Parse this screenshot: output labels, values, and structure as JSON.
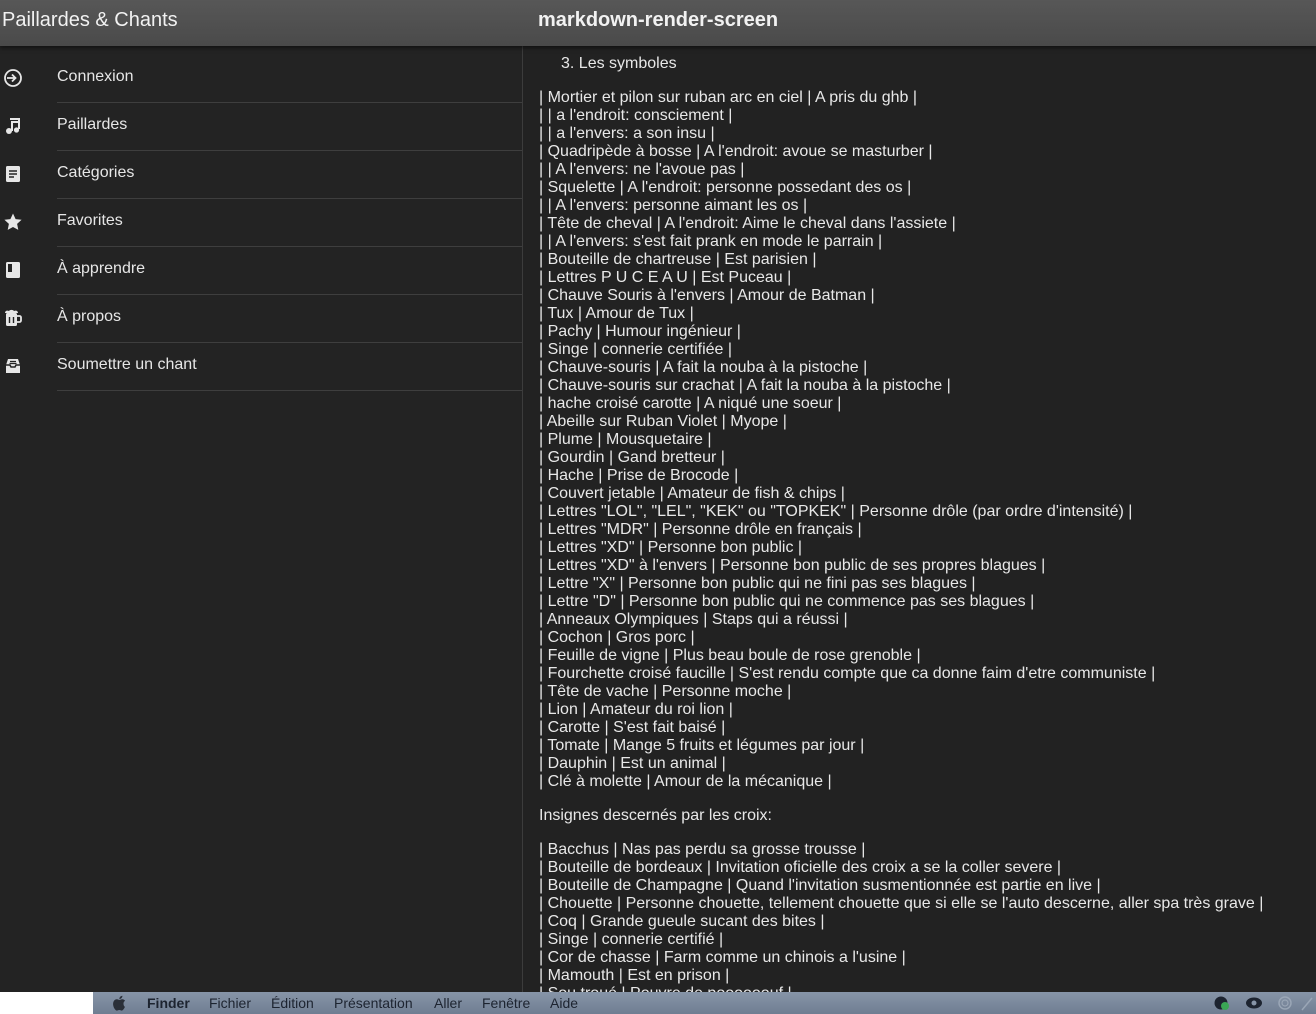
{
  "header": {
    "app_title": "Paillardes & Chants",
    "screen_title": "markdown-render-screen"
  },
  "sidebar": {
    "items": [
      {
        "label": "Connexion",
        "icon": "login-icon"
      },
      {
        "label": "Paillardes",
        "icon": "music-note-icon"
      },
      {
        "label": "Catégories",
        "icon": "document-icon"
      },
      {
        "label": "Favorites",
        "icon": "star-icon"
      },
      {
        "label": "À apprendre",
        "icon": "book-icon"
      },
      {
        "label": "À propos",
        "icon": "beer-mug-icon"
      },
      {
        "label": "Soumettre un chant",
        "icon": "inbox-icon"
      }
    ]
  },
  "content": {
    "ol_item": "3. Les symboles",
    "symbols_lines": [
      "| Mortier et pilon sur ruban arc en ciel | A pris du ghb |",
      "| | a l'endroit: consciement |",
      "| | a l'envers: a son insu |",
      "| Quadripède à bosse | A l'endroit: avoue se masturber |",
      "| | A l'envers: ne l'avoue pas |",
      "| Squelette | A l'endroit: personne possedant des os |",
      "| | A l'envers: personne aimant les os |",
      "| Tête de cheval | A l'endroit: Aime le cheval dans l'assiete |",
      "| | A l'envers: s'est fait prank en mode le parrain |",
      "| Bouteille de chartreuse | Est parisien |",
      "| Lettres P U C E A U | Est Puceau |",
      "| Chauve Souris à l'envers | Amour de Batman |",
      "| Tux | Amour de Tux |",
      "| Pachy | Humour ingénieur |",
      "| Singe | connerie certifiée |",
      "| Chauve-souris | A fait la nouba à la pistoche |",
      "| Chauve-souris sur crachat | A fait la nouba à la pistoche |",
      "| hache croisé carotte | A niqué une soeur |",
      "| Abeille sur Ruban Violet | Myope |",
      "| Plume | Mousquetaire |",
      "| Gourdin | Gand bretteur |",
      "| Hache | Prise de Brocode |",
      "| Couvert jetable | Amateur de fish & chips |",
      "| Lettres \"LOL\", \"LEL\", \"KEK\" ou \"TOPKEK\" | Personne drôle (par ordre d'intensité) |",
      "| Lettres \"MDR\" | Personne drôle en français |",
      "| Lettres \"XD\" | Personne bon public |",
      "| Lettres \"XD\" à l'envers | Personne bon public de ses propres blagues |",
      "| Lettre \"X\" | Personne bon public qui ne fini pas ses blagues |",
      "| Lettre \"D\" | Personne bon public qui ne commence pas ses blagues |",
      "| Anneaux Olympiques | Staps qui a réussi |",
      "| Cochon | Gros porc |",
      "| Feuille de vigne | Plus beau boule de rose grenoble |",
      "| Fourchette croisé faucille | S'est rendu compte que ca donne faim d'etre communiste |",
      "| Tête de vache | Personne moche |",
      "| Lion | Amateur du roi lion |",
      "| Carotte | S'est fait baisé |",
      "| Tomate | Mange 5 fruits et légumes par jour |",
      "| Dauphin | Est un animal |",
      "| Clé à molette | Amour de la mécanique |"
    ],
    "croix_heading": "Insignes descernés par les croix:",
    "croix_lines": [
      "| Bacchus | Nas pas perdu sa grosse trousse |",
      "| Bouteille de bordeaux | Invitation oficielle des croix a se la coller severe |",
      "| Bouteille de Champagne | Quand l'invitation susmentionnée est partie en live |",
      "| Chouette | Personne chouette, tellement chouette que si elle se l'auto descerne, aller spa très grave |",
      "| Coq | Grande gueule sucant des bites |",
      "| Singe | connerie certifié |",
      "| Cor de chasse | Farm comme un chinois a l'usine |",
      "| Mamouth | Est en prison |",
      "| Sou troué | Pouvre de poooooouf |"
    ]
  },
  "menubar": {
    "items": [
      "Finder",
      "Fichier",
      "Édition",
      "Présentation",
      "Aller",
      "Fenêtre",
      "Aide"
    ]
  }
}
